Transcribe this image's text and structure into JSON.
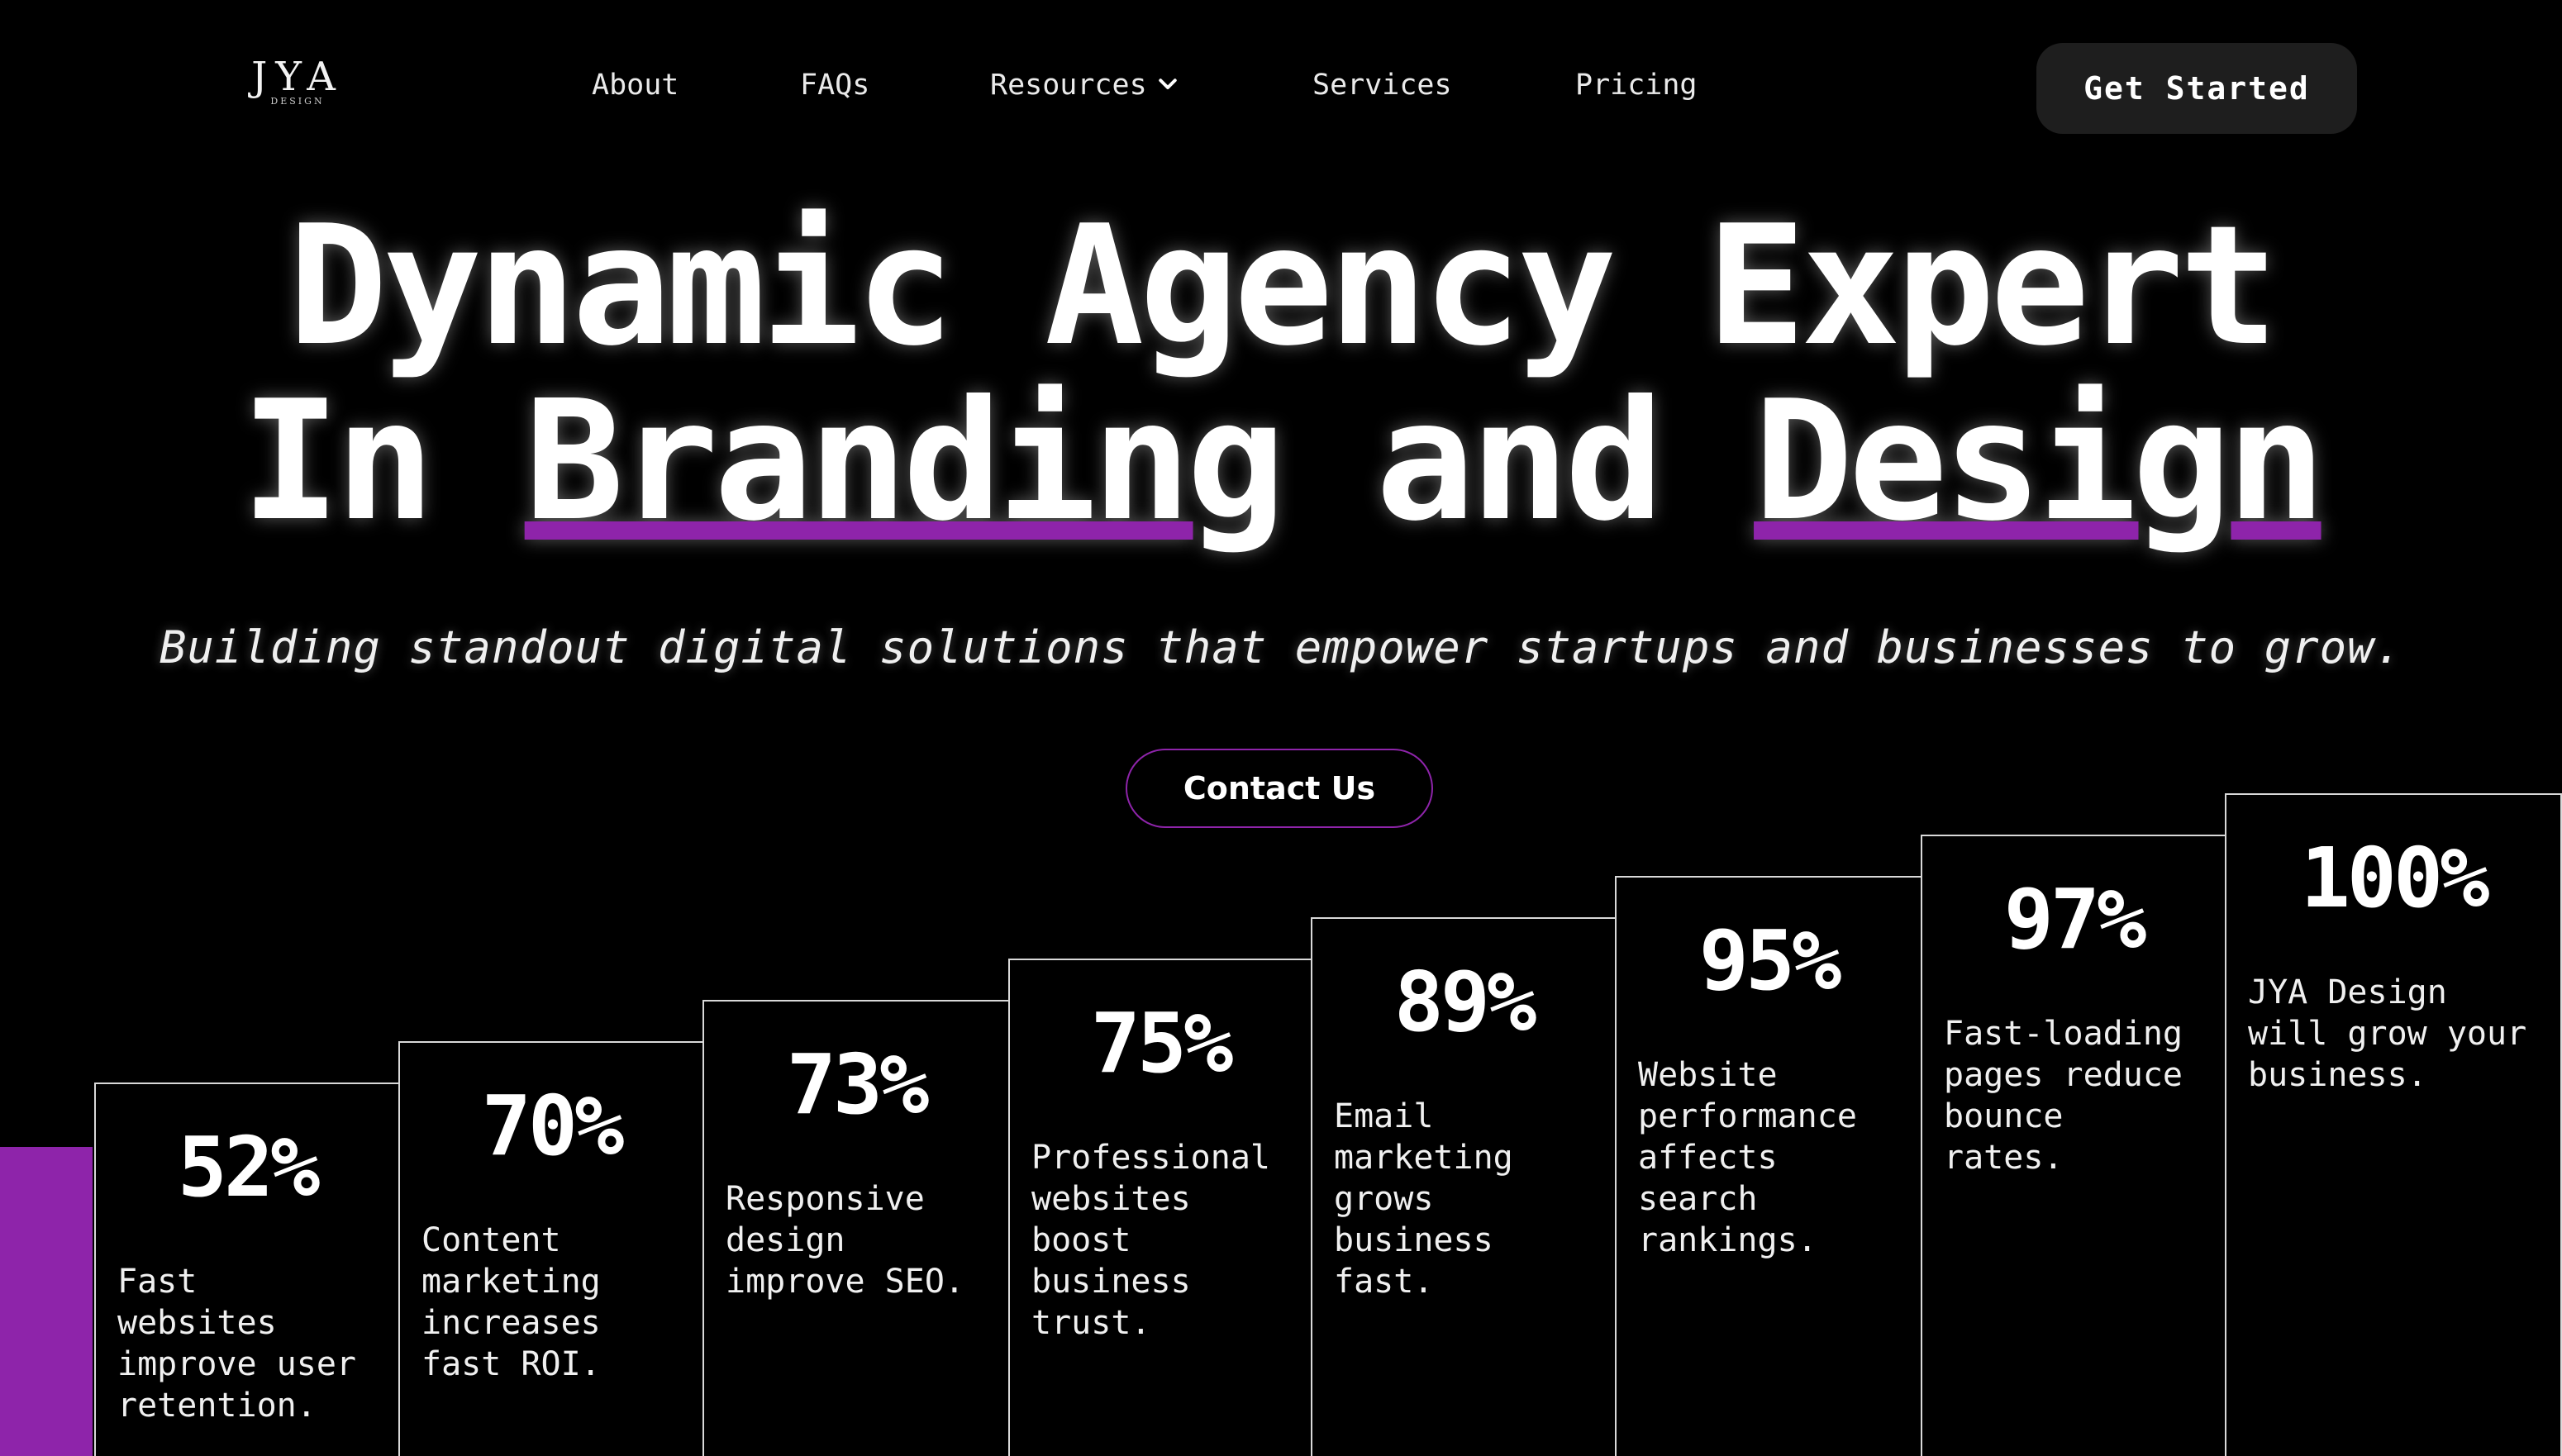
{
  "logo": {
    "text": "JYA",
    "subtext": "DESIGN"
  },
  "nav": {
    "items": [
      "About",
      "FAQs",
      "Resources",
      "Services",
      "Pricing"
    ],
    "cta": "Get Started"
  },
  "hero": {
    "line1": "Dynamic Agency Expert",
    "line2_prefix": "In ",
    "highlight1": "Branding",
    "line2_mid": " and ",
    "highlight2": "Design",
    "accent_color": "#8e24aa"
  },
  "subtitle": "Building standout digital solutions that empower startups and businesses to grow.",
  "contact_button": "Contact Us",
  "stats": [
    {
      "value": "52%",
      "desc": "Fast\nwebsites\nimprove user\nretention."
    },
    {
      "value": "70%",
      "desc": "Content\nmarketing\nincreases\nfast ROI."
    },
    {
      "value": "73%",
      "desc": "Responsive\ndesign\nimprove SEO."
    },
    {
      "value": "75%",
      "desc": "Professional\nwebsites\nboost\nbusiness\ntrust."
    },
    {
      "value": "89%",
      "desc": "Email\nmarketing\ngrows\nbusiness\nfast."
    },
    {
      "value": "95%",
      "desc": "Website\nperformance\naffects\nsearch\nrankings."
    },
    {
      "value": "97%",
      "desc": "Fast-loading\npages reduce\nbounce\nrates."
    },
    {
      "value": "100%",
      "desc": "JYA Design\nwill grow your\nbusiness."
    }
  ]
}
